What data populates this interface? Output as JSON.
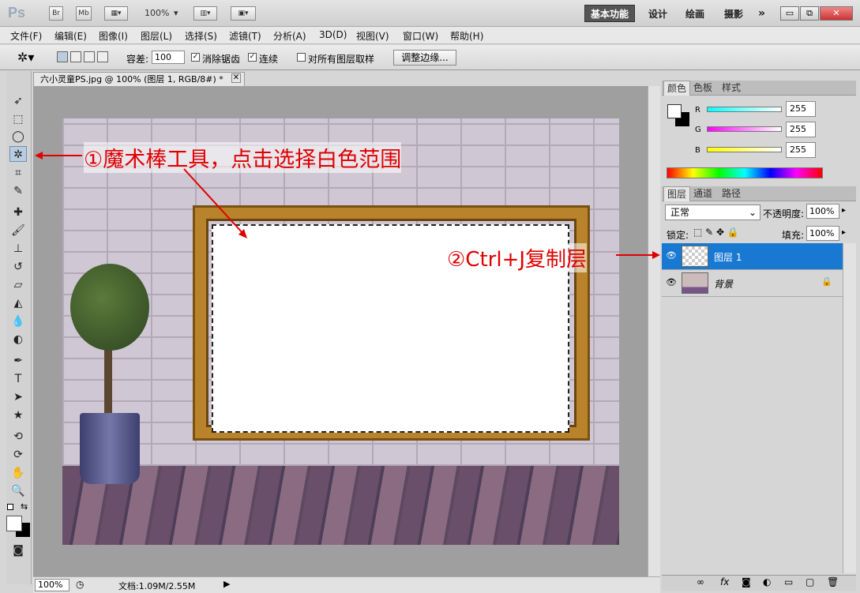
{
  "app": {
    "logo": "Ps",
    "zoom": "100%",
    "bridge": "Br",
    "minibridge": "Mb"
  },
  "workspaces": {
    "active": "基本功能",
    "items": [
      "设计",
      "绘画",
      "摄影"
    ],
    "more": "»"
  },
  "window_buttons": {
    "minimize": "▭",
    "restore": "⧉",
    "close": "✕"
  },
  "menu": [
    "文件(F)",
    "编辑(E)",
    "图像(I)",
    "图层(L)",
    "选择(S)",
    "滤镜(T)",
    "分析(A)",
    "3D(D)",
    "视图(V)",
    "窗口(W)",
    "帮助(H)"
  ],
  "options": {
    "tolerance_label": "容差:",
    "tolerance_value": "100",
    "antialias": "消除锯齿",
    "contiguous": "连续",
    "sample_all": "对所有图层取样",
    "refine_edge": "调整边缘..."
  },
  "document": {
    "tab": "六小灵童PS.jpg @ 100% (图层 1, RGB/8#) *",
    "close": "✕"
  },
  "status": {
    "zoom": "100%",
    "doc": "文档:1.09M/2.55M"
  },
  "annotations": {
    "step1": "①魔术棒工具，点击选择白色范围",
    "step2": "②Ctrl+J复制层"
  },
  "color_panel": {
    "tabs": [
      "颜色",
      "色板",
      "样式"
    ],
    "channels": [
      {
        "label": "R",
        "value": "255",
        "color": "#00e0e0"
      },
      {
        "label": "G",
        "value": "255",
        "color": "#e000e0"
      },
      {
        "label": "B",
        "value": "255",
        "color": "#e0e000"
      }
    ]
  },
  "layers_panel": {
    "tabs": [
      "图层",
      "通道",
      "路径"
    ],
    "blend_mode": "正常",
    "opacity_label": "不透明度:",
    "opacity": "100%",
    "lock_label": "锁定:",
    "fill_label": "填充:",
    "fill": "100%",
    "layers": [
      {
        "name": "图层 1",
        "selected": true
      },
      {
        "name": "背景",
        "selected": false
      }
    ]
  },
  "colors": {
    "accent": "#1878d2",
    "annotation": "#e00000"
  }
}
